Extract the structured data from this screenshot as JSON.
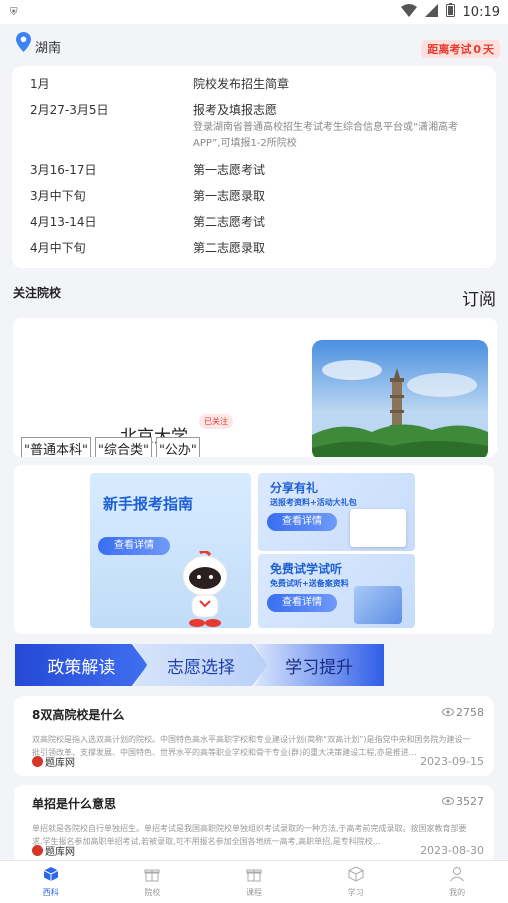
{
  "status_bar": {
    "time": "10:19"
  },
  "header": {
    "location": "湖南",
    "countdown_prefix": "距离考试",
    "countdown_days": "0",
    "countdown_unit": "天"
  },
  "schedule": [
    {
      "date": "1月",
      "event": "院校发布招生简章",
      "note": ""
    },
    {
      "date": "2月27-3月5日",
      "event": "报考及填报志愿",
      "note": "登录湖南省普通高校招生考试考生综合信息平台或“潇湘高考APP”,可填报1-2所院校"
    },
    {
      "date": "3月16-17日",
      "event": "第一志愿考试",
      "note": ""
    },
    {
      "date": "3月中下旬",
      "event": "第一志愿录取",
      "note": ""
    },
    {
      "date": "4月13-14日",
      "event": "第二志愿考试",
      "note": ""
    },
    {
      "date": "4月中下旬",
      "event": "第二志愿录取",
      "note": ""
    }
  ],
  "followed_section": {
    "title": "关注院校",
    "subscribe_label": "订阅"
  },
  "school": {
    "name": "北京大学",
    "badge": "已关注",
    "tags": [
      "\"普通本科\"",
      "\"综合类\"",
      "\"公办\""
    ]
  },
  "promo": {
    "left_title": "新手报考指南",
    "left_button": "查看详情",
    "r1_title": "分享有礼",
    "r1_sub": "送报考资料+活动大礼包",
    "r1_button": "查看详情",
    "r2_title": "免费试学试听",
    "r2_sub": "免费试听+送备案资料",
    "r2_button": "查看详情"
  },
  "tabs": [
    "政策解读",
    "志愿选择",
    "学习提升"
  ],
  "news": [
    {
      "title": "8双高院校是什么",
      "views": "2758",
      "desc": "双高院校是指入选双高计划的院校。中国特色高水平高职学校和专业建设计划(简称“双高计划”)是指党中央和国务院为建设一批引领改革、支撑发展、中国特色、世界水平的高等职业学校和骨干专业(群)的重大决策建设工程,亦是推进…",
      "source": "题库网",
      "date": "2023-09-15"
    },
    {
      "title": "单招是什么意思",
      "views": "3527",
      "desc": "单招就是各院校自行单独招生。单招考试是我国高职院校单独组织考试录取的一种方法,于高考前完成录取。按国家教育部要求,学生报名参加高职单招考试,若被录取,可不用报名参加全国各地统一高考,高职单招,是专科院校…",
      "source": "题库网",
      "date": "2023-08-30"
    }
  ],
  "bottom_nav": [
    {
      "label": "西科",
      "icon": "cube-icon",
      "active": true
    },
    {
      "label": "院校",
      "icon": "gift-icon",
      "active": false
    },
    {
      "label": "课程",
      "icon": "gift-icon",
      "active": false
    },
    {
      "label": "学习",
      "icon": "box-icon",
      "active": false
    },
    {
      "label": "我的",
      "icon": "user-icon",
      "active": false
    }
  ],
  "colors": {
    "accent": "#2b67e8",
    "countdown": "#e8392e",
    "tab_blue": "#2f5ee8"
  }
}
